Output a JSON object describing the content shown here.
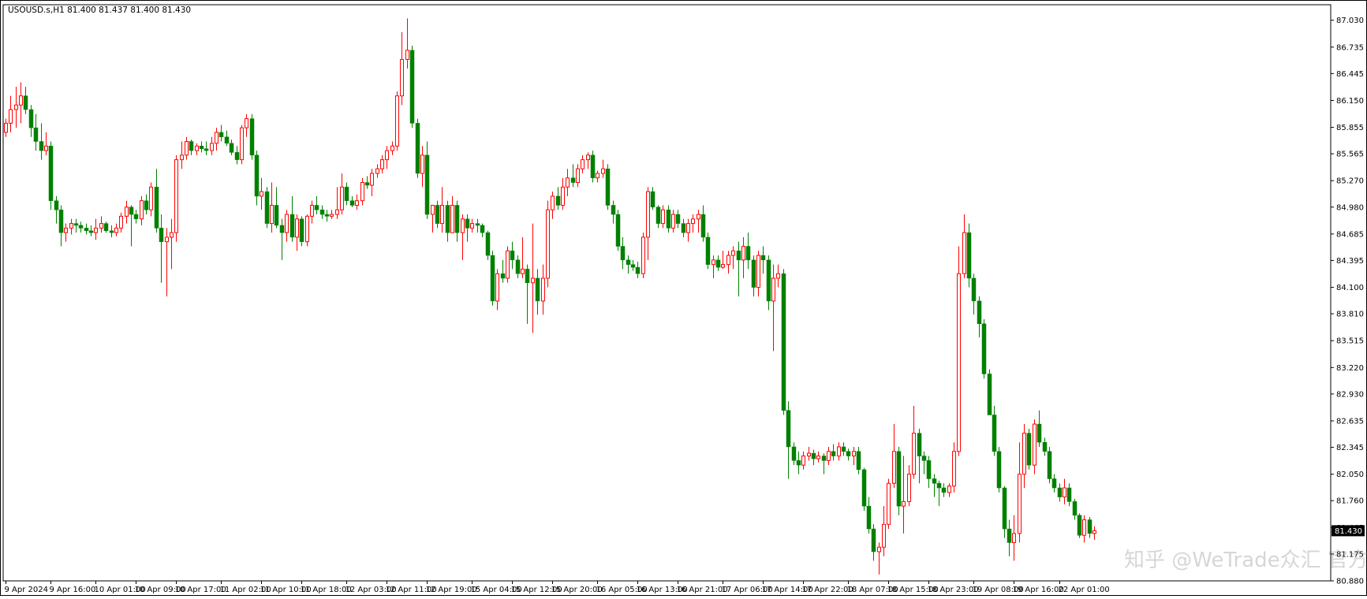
{
  "chart_data": {
    "type": "candlestick",
    "symbol_info": "USOUSD.s,H1  81.400 81.437 81.400 81.430",
    "last_price_label": "81.430",
    "ylim": [
      80.88,
      87.2
    ],
    "y_ticks": [
      "87.030",
      "86.735",
      "86.445",
      "86.150",
      "85.855",
      "85.565",
      "85.270",
      "84.980",
      "84.685",
      "84.395",
      "84.100",
      "83.810",
      "83.515",
      "83.220",
      "82.930",
      "82.635",
      "82.345",
      "82.050",
      "81.760",
      "81.465",
      "81.175",
      "80.880"
    ],
    "x_ticks": [
      {
        "label": "9 Apr 2024",
        "index": 0
      },
      {
        "label": "9 Apr 16:00",
        "index": 9
      },
      {
        "label": "10 Apr 01:00",
        "index": 18
      },
      {
        "label": "10 Apr 09:00",
        "index": 26
      },
      {
        "label": "10 Apr 17:00",
        "index": 34
      },
      {
        "label": "11 Apr 02:00",
        "index": 43
      },
      {
        "label": "11 Apr 10:00",
        "index": 51
      },
      {
        "label": "11 Apr 18:00",
        "index": 59
      },
      {
        "label": "12 Apr 03:00",
        "index": 68
      },
      {
        "label": "12 Apr 11:00",
        "index": 76
      },
      {
        "label": "12 Apr 19:00",
        "index": 84
      },
      {
        "label": "15 Apr 04:00",
        "index": 93
      },
      {
        "label": "15 Apr 12:00",
        "index": 101
      },
      {
        "label": "15 Apr 20:00",
        "index": 109
      },
      {
        "label": "16 Apr 05:00",
        "index": 118
      },
      {
        "label": "16 Apr 13:00",
        "index": 126
      },
      {
        "label": "16 Apr 21:00",
        "index": 134
      },
      {
        "label": "17 Apr 06:00",
        "index": 143
      },
      {
        "label": "17 Apr 14:00",
        "index": 151
      },
      {
        "label": "17 Apr 22:00",
        "index": 159
      },
      {
        "label": "18 Apr 07:00",
        "index": 168
      },
      {
        "label": "18 Apr 15:00",
        "index": 176
      },
      {
        "label": "18 Apr 23:00",
        "index": 184
      },
      {
        "label": "19 Apr 08:00",
        "index": 193
      },
      {
        "label": "19 Apr 16:00",
        "index": 201
      },
      {
        "label": "22 Apr 01:00",
        "index": 210
      }
    ],
    "colors": {
      "up": "#ff0000",
      "down": "#008000",
      "grid": "#ffffff",
      "axis": "#000000",
      "background": "#ffffff"
    },
    "ohlc": [
      [
        85.8,
        85.95,
        85.75,
        85.9
      ],
      [
        85.9,
        86.2,
        85.8,
        86.05
      ],
      [
        86.05,
        86.3,
        85.85,
        86.1
      ],
      [
        86.1,
        86.35,
        85.9,
        86.2
      ],
      [
        86.2,
        86.3,
        86.0,
        86.05
      ],
      [
        86.05,
        86.1,
        85.75,
        85.85
      ],
      [
        85.85,
        86.0,
        85.6,
        85.7
      ],
      [
        85.7,
        85.9,
        85.5,
        85.6
      ],
      [
        85.6,
        85.8,
        85.55,
        85.65
      ],
      [
        85.65,
        85.7,
        84.95,
        85.05
      ],
      [
        85.05,
        85.1,
        84.8,
        84.95
      ],
      [
        84.95,
        85.0,
        84.55,
        84.7
      ],
      [
        84.7,
        84.8,
        84.6,
        84.75
      ],
      [
        84.75,
        84.85,
        84.68,
        84.8
      ],
      [
        84.8,
        84.85,
        84.7,
        84.78
      ],
      [
        84.78,
        84.82,
        84.7,
        84.75
      ],
      [
        84.75,
        84.8,
        84.68,
        84.72
      ],
      [
        84.72,
        84.78,
        84.66,
        84.7
      ],
      [
        84.7,
        84.85,
        84.62,
        84.75
      ],
      [
        84.75,
        84.88,
        84.7,
        84.8
      ],
      [
        84.8,
        84.82,
        84.7,
        84.72
      ],
      [
        84.72,
        84.78,
        84.65,
        84.7
      ],
      [
        84.7,
        84.8,
        84.66,
        84.75
      ],
      [
        84.75,
        84.92,
        84.7,
        84.88
      ],
      [
        84.88,
        85.05,
        84.8,
        84.98
      ],
      [
        84.98,
        85.0,
        84.55,
        84.9
      ],
      [
        84.9,
        84.95,
        84.8,
        84.85
      ],
      [
        84.85,
        85.1,
        84.78,
        85.05
      ],
      [
        85.05,
        85.12,
        84.9,
        84.95
      ],
      [
        84.95,
        85.25,
        84.88,
        85.2
      ],
      [
        85.2,
        85.4,
        84.7,
        84.75
      ],
      [
        84.75,
        84.9,
        84.15,
        84.6
      ],
      [
        84.6,
        84.75,
        84.0,
        84.65
      ],
      [
        84.65,
        84.85,
        84.3,
        84.7
      ],
      [
        84.7,
        85.55,
        84.6,
        85.5
      ],
      [
        85.5,
        85.7,
        85.4,
        85.55
      ],
      [
        85.55,
        85.75,
        85.5,
        85.7
      ],
      [
        85.7,
        85.72,
        85.55,
        85.6
      ],
      [
        85.6,
        85.68,
        85.55,
        85.65
      ],
      [
        85.65,
        85.7,
        85.58,
        85.62
      ],
      [
        85.62,
        85.7,
        85.55,
        85.6
      ],
      [
        85.6,
        85.75,
        85.55,
        85.68
      ],
      [
        85.68,
        85.85,
        85.6,
        85.8
      ],
      [
        85.8,
        85.88,
        85.7,
        85.75
      ],
      [
        85.75,
        85.82,
        85.65,
        85.68
      ],
      [
        85.68,
        85.72,
        85.55,
        85.58
      ],
      [
        85.58,
        85.65,
        85.45,
        85.5
      ],
      [
        85.5,
        85.88,
        85.45,
        85.85
      ],
      [
        85.85,
        86.0,
        85.75,
        85.95
      ],
      [
        85.95,
        86.0,
        85.5,
        85.55
      ],
      [
        85.55,
        85.6,
        85.0,
        85.1
      ],
      [
        85.1,
        85.3,
        84.95,
        85.15
      ],
      [
        85.15,
        85.2,
        84.75,
        84.8
      ],
      [
        84.8,
        85.25,
        84.7,
        85.0
      ],
      [
        85.0,
        85.2,
        84.75,
        84.78
      ],
      [
        84.78,
        84.85,
        84.4,
        84.7
      ],
      [
        84.7,
        84.95,
        84.6,
        84.9
      ],
      [
        84.9,
        85.1,
        84.6,
        84.65
      ],
      [
        84.65,
        84.9,
        84.5,
        84.85
      ],
      [
        84.85,
        84.88,
        84.55,
        84.6
      ],
      [
        84.6,
        84.9,
        84.55,
        84.88
      ],
      [
        84.88,
        85.05,
        84.8,
        85.0
      ],
      [
        85.0,
        85.1,
        84.9,
        84.95
      ],
      [
        84.95,
        85.0,
        84.85,
        84.9
      ],
      [
        84.9,
        84.95,
        84.82,
        84.88
      ],
      [
        84.88,
        84.95,
        84.85,
        84.9
      ],
      [
        84.9,
        85.2,
        84.85,
        84.95
      ],
      [
        84.95,
        85.35,
        84.9,
        85.2
      ],
      [
        85.2,
        85.25,
        85.0,
        85.05
      ],
      [
        85.05,
        85.1,
        84.98,
        85.0
      ],
      [
        85.0,
        85.12,
        84.95,
        85.05
      ],
      [
        85.05,
        85.3,
        85.0,
        85.25
      ],
      [
        85.25,
        85.32,
        85.18,
        85.22
      ],
      [
        85.22,
        85.4,
        85.1,
        85.35
      ],
      [
        85.35,
        85.45,
        85.3,
        85.4
      ],
      [
        85.4,
        85.55,
        85.35,
        85.5
      ],
      [
        85.5,
        85.65,
        85.4,
        85.6
      ],
      [
        85.6,
        85.7,
        85.55,
        85.65
      ],
      [
        85.65,
        86.25,
        85.6,
        86.2
      ],
      [
        86.2,
        86.9,
        86.1,
        86.6
      ],
      [
        86.6,
        87.05,
        86.5,
        86.7
      ],
      [
        86.7,
        86.75,
        85.85,
        85.9
      ],
      [
        85.9,
        85.95,
        85.3,
        85.35
      ],
      [
        85.35,
        85.65,
        85.2,
        85.55
      ],
      [
        85.55,
        85.7,
        84.85,
        84.9
      ],
      [
        84.9,
        85.0,
        84.7,
        85.0
      ],
      [
        85.0,
        85.05,
        84.75,
        84.8
      ],
      [
        84.8,
        85.2,
        84.7,
        85.0
      ],
      [
        85.0,
        85.05,
        84.6,
        84.7
      ],
      [
        84.7,
        85.1,
        84.7,
        85.0
      ],
      [
        85.0,
        85.05,
        84.6,
        84.7
      ],
      [
        84.7,
        84.9,
        84.4,
        84.85
      ],
      [
        84.85,
        84.9,
        84.6,
        84.75
      ],
      [
        84.75,
        84.85,
        84.7,
        84.8
      ],
      [
        84.8,
        84.85,
        84.7,
        84.78
      ],
      [
        84.78,
        84.8,
        84.65,
        84.7
      ],
      [
        84.7,
        84.72,
        84.4,
        84.45
      ],
      [
        84.45,
        84.5,
        83.9,
        83.95
      ],
      [
        83.95,
        84.3,
        83.85,
        84.25
      ],
      [
        84.25,
        84.4,
        84.15,
        84.2
      ],
      [
        84.2,
        84.55,
        84.15,
        84.5
      ],
      [
        84.5,
        84.6,
        84.3,
        84.4
      ],
      [
        84.4,
        84.45,
        84.2,
        84.25
      ],
      [
        84.25,
        84.65,
        84.2,
        84.3
      ],
      [
        84.3,
        84.35,
        83.7,
        84.15
      ],
      [
        84.15,
        84.8,
        83.6,
        84.2
      ],
      [
        84.2,
        84.3,
        83.8,
        83.95
      ],
      [
        83.95,
        84.35,
        83.8,
        84.2
      ],
      [
        84.2,
        85.05,
        84.1,
        84.95
      ],
      [
        84.95,
        85.15,
        84.85,
        85.1
      ],
      [
        85.1,
        85.2,
        84.95,
        85.0
      ],
      [
        85.0,
        85.3,
        84.95,
        85.2
      ],
      [
        85.2,
        85.4,
        85.1,
        85.3
      ],
      [
        85.3,
        85.45,
        85.2,
        85.25
      ],
      [
        85.25,
        85.45,
        85.2,
        85.4
      ],
      [
        85.4,
        85.55,
        85.35,
        85.5
      ],
      [
        85.5,
        85.58,
        85.4,
        85.55
      ],
      [
        85.55,
        85.6,
        85.25,
        85.3
      ],
      [
        85.3,
        85.38,
        85.25,
        85.35
      ],
      [
        85.35,
        85.5,
        85.3,
        85.4
      ],
      [
        85.4,
        85.45,
        84.95,
        85.0
      ],
      [
        85.0,
        85.05,
        84.8,
        84.9
      ],
      [
        84.9,
        84.95,
        84.5,
        84.55
      ],
      [
        84.55,
        84.65,
        84.3,
        84.4
      ],
      [
        84.4,
        84.45,
        84.25,
        84.35
      ],
      [
        84.35,
        84.4,
        84.28,
        84.32
      ],
      [
        84.32,
        84.38,
        84.2,
        84.25
      ],
      [
        84.25,
        84.7,
        84.2,
        84.65
      ],
      [
        84.65,
        85.2,
        84.4,
        85.15
      ],
      [
        85.15,
        85.2,
        84.95,
        84.98
      ],
      [
        84.98,
        85.0,
        84.75,
        84.8
      ],
      [
        84.8,
        85.0,
        84.75,
        84.95
      ],
      [
        84.95,
        85.0,
        84.7,
        84.75
      ],
      [
        84.75,
        84.95,
        84.7,
        84.9
      ],
      [
        84.9,
        84.95,
        84.75,
        84.8
      ],
      [
        84.8,
        84.85,
        84.65,
        84.7
      ],
      [
        84.7,
        84.85,
        84.6,
        84.8
      ],
      [
        84.8,
        84.9,
        84.7,
        84.85
      ],
      [
        84.85,
        84.95,
        84.7,
        84.9
      ],
      [
        84.9,
        85.0,
        84.6,
        84.65
      ],
      [
        84.65,
        84.7,
        84.3,
        84.35
      ],
      [
        84.35,
        84.45,
        84.2,
        84.4
      ],
      [
        84.4,
        84.45,
        84.28,
        84.32
      ],
      [
        84.32,
        84.5,
        84.3,
        84.35
      ],
      [
        84.35,
        84.5,
        84.25,
        84.45
      ],
      [
        84.45,
        84.55,
        84.3,
        84.5
      ],
      [
        84.5,
        84.6,
        84.0,
        84.4
      ],
      [
        84.4,
        84.65,
        84.2,
        84.55
      ],
      [
        84.55,
        84.7,
        84.3,
        84.4
      ],
      [
        84.4,
        84.45,
        84.0,
        84.1
      ],
      [
        84.1,
        84.5,
        84.0,
        84.45
      ],
      [
        84.45,
        84.55,
        84.25,
        84.4
      ],
      [
        84.4,
        84.45,
        83.85,
        83.95
      ],
      [
        83.95,
        84.35,
        83.4,
        84.2
      ],
      [
        84.2,
        84.35,
        84.1,
        84.25
      ],
      [
        84.25,
        84.3,
        82.7,
        82.75
      ],
      [
        82.75,
        82.85,
        82.0,
        82.35
      ],
      [
        82.35,
        82.4,
        82.15,
        82.2
      ],
      [
        82.2,
        82.3,
        82.05,
        82.15
      ],
      [
        82.15,
        82.3,
        82.1,
        82.25
      ],
      [
        82.25,
        82.35,
        82.2,
        82.28
      ],
      [
        82.28,
        82.32,
        82.15,
        82.22
      ],
      [
        82.22,
        82.3,
        82.18,
        82.25
      ],
      [
        82.25,
        82.28,
        82.05,
        82.2
      ],
      [
        82.2,
        82.35,
        82.15,
        82.3
      ],
      [
        82.3,
        82.38,
        82.2,
        82.25
      ],
      [
        82.25,
        82.4,
        82.2,
        82.35
      ],
      [
        82.35,
        82.4,
        82.25,
        82.3
      ],
      [
        82.3,
        82.33,
        82.2,
        82.25
      ],
      [
        82.25,
        82.35,
        82.15,
        82.3
      ],
      [
        82.3,
        82.35,
        82.05,
        82.1
      ],
      [
        82.1,
        82.12,
        81.65,
        81.7
      ],
      [
        81.7,
        81.8,
        81.4,
        81.45
      ],
      [
        81.45,
        81.5,
        81.1,
        81.2
      ],
      [
        81.2,
        81.3,
        80.95,
        81.25
      ],
      [
        81.25,
        81.7,
        81.15,
        81.5
      ],
      [
        81.5,
        82.0,
        81.45,
        81.95
      ],
      [
        81.95,
        82.6,
        81.9,
        82.3
      ],
      [
        82.3,
        82.35,
        81.6,
        81.7
      ],
      [
        81.7,
        82.25,
        81.4,
        81.75
      ],
      [
        81.75,
        82.15,
        81.7,
        82.05
      ],
      [
        82.05,
        82.8,
        82.0,
        82.5
      ],
      [
        82.5,
        82.55,
        81.95,
        82.25
      ],
      [
        82.25,
        82.3,
        82.05,
        82.2
      ],
      [
        82.2,
        82.25,
        81.9,
        82.0
      ],
      [
        82.0,
        82.05,
        81.8,
        81.95
      ],
      [
        81.95,
        81.98,
        81.7,
        81.9
      ],
      [
        81.9,
        81.95,
        81.8,
        81.85
      ],
      [
        81.85,
        81.95,
        81.8,
        81.92
      ],
      [
        81.92,
        82.4,
        81.85,
        82.3
      ],
      [
        82.3,
        84.55,
        82.25,
        84.25
      ],
      [
        84.25,
        84.9,
        84.2,
        84.7
      ],
      [
        84.7,
        84.8,
        84.1,
        84.2
      ],
      [
        84.2,
        84.25,
        83.8,
        83.95
      ],
      [
        83.95,
        84.0,
        83.55,
        83.7
      ],
      [
        83.7,
        83.75,
        83.1,
        83.15
      ],
      [
        83.15,
        83.2,
        82.7,
        82.7
      ],
      [
        82.7,
        82.8,
        82.25,
        82.3
      ],
      [
        82.3,
        82.35,
        81.85,
        81.9
      ],
      [
        81.9,
        81.92,
        81.35,
        81.45
      ],
      [
        81.45,
        81.55,
        81.15,
        81.3
      ],
      [
        81.3,
        81.6,
        81.1,
        81.4
      ],
      [
        81.4,
        82.4,
        81.3,
        82.05
      ],
      [
        82.05,
        82.6,
        81.9,
        82.5
      ],
      [
        82.5,
        82.55,
        82.1,
        82.15
      ],
      [
        82.15,
        82.65,
        82.05,
        82.6
      ],
      [
        82.6,
        82.75,
        82.35,
        82.4
      ],
      [
        82.4,
        82.45,
        82.25,
        82.3
      ],
      [
        82.3,
        82.35,
        81.95,
        82.0
      ],
      [
        82.0,
        82.05,
        81.85,
        81.9
      ],
      [
        81.9,
        81.95,
        81.75,
        81.8
      ],
      [
        81.8,
        82.0,
        81.72,
        81.9
      ],
      [
        81.9,
        81.95,
        81.7,
        81.75
      ],
      [
        81.75,
        81.78,
        81.55,
        81.6
      ],
      [
        81.6,
        81.62,
        81.35,
        81.38
      ],
      [
        81.38,
        81.6,
        81.3,
        81.55
      ],
      [
        81.55,
        81.58,
        81.35,
        81.4
      ],
      [
        81.4,
        81.48,
        81.33,
        81.43
      ]
    ]
  },
  "watermark_text": "知乎 @WeTrade众汇 官方"
}
